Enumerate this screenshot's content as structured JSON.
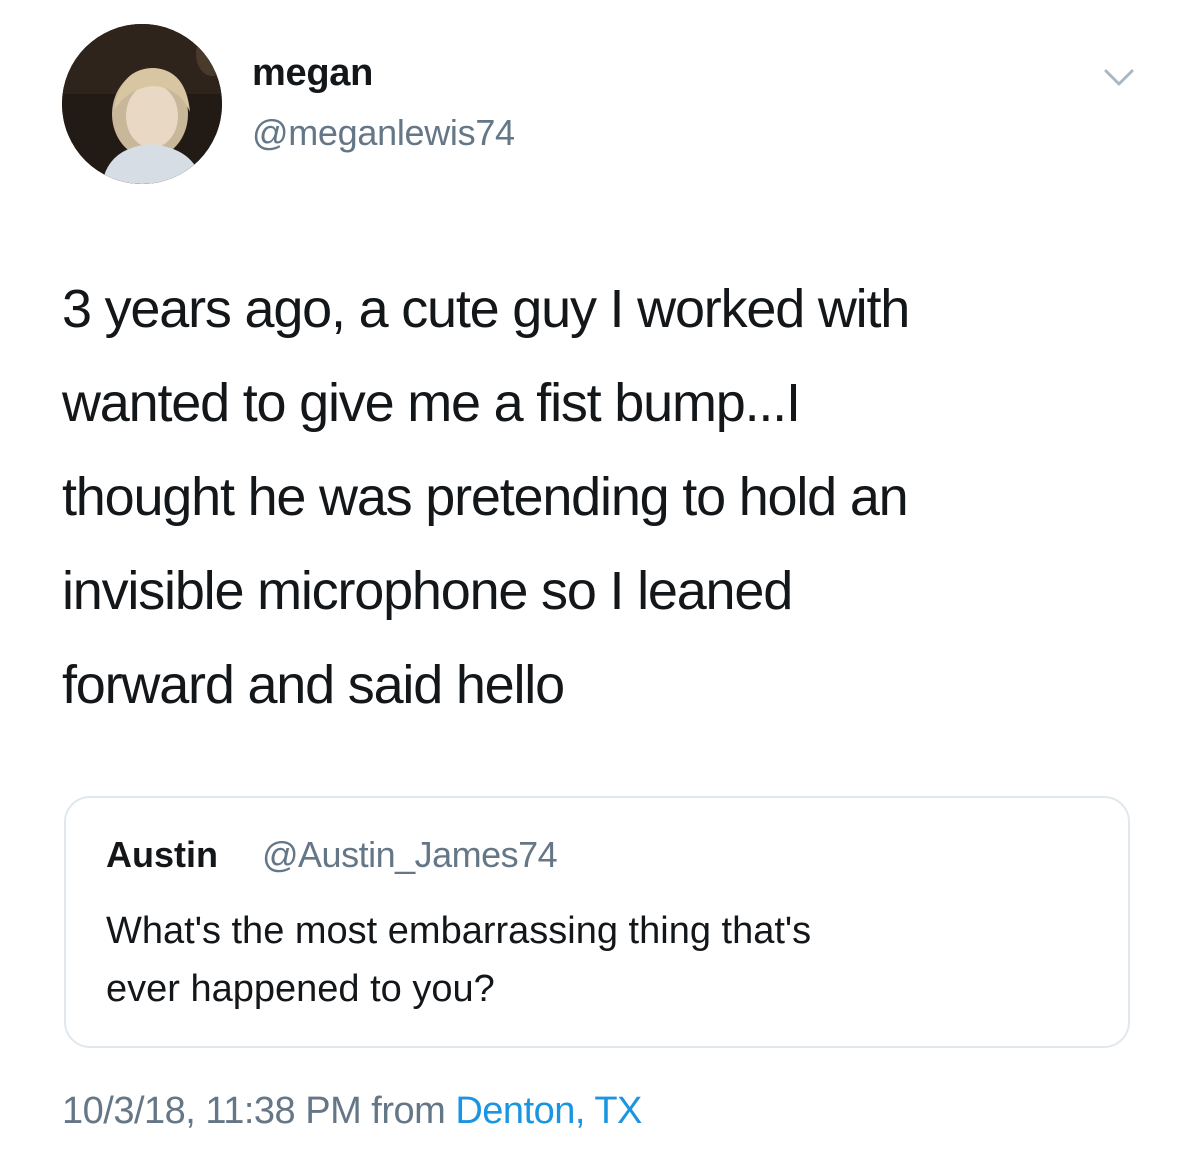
{
  "author": {
    "display_name": "megan",
    "handle": "@meganlewis74",
    "avatar_icon": "profile-photo"
  },
  "menu": {
    "caret_icon": "chevron-down-icon"
  },
  "tweet": {
    "text": "3 years ago, a cute guy I worked with\nwanted to give me a fist bump...I\nthought he was pretending to hold an\ninvisible microphone so I leaned\nforward and said hello"
  },
  "quoted_tweet": {
    "display_name": "Austin",
    "handle": "@Austin_James74",
    "text": "What's the most embarrassing thing that's\never happened to you?"
  },
  "meta": {
    "timestamp": "10/3/18, 11:38 PM",
    "from_label": "from",
    "location": "Denton, TX"
  },
  "colors": {
    "primary_text": "#14171a",
    "secondary_text": "#657786",
    "link": "#1b95e0",
    "border": "#e1e8ed"
  }
}
